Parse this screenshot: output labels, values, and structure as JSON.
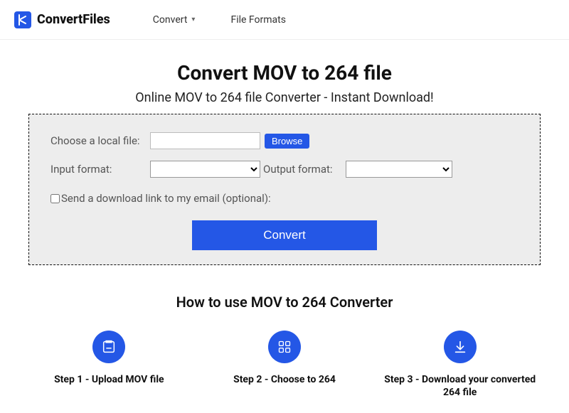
{
  "brand": {
    "name": "ConvertFiles"
  },
  "nav": {
    "convert": "Convert",
    "formats": "File Formats"
  },
  "hero": {
    "title": "Convert MOV to 264 file",
    "subtitle": "Online MOV to 264 file Converter - Instant Download!"
  },
  "form": {
    "choose_label": "Choose a local file:",
    "input_value": "",
    "browse": "Browse",
    "input_format_label": "Input format:",
    "output_format_label": "Output format:",
    "email_opt_label": "Send a download link to my email (optional):",
    "convert_btn": "Convert"
  },
  "howto": {
    "heading": "How to use MOV to 264 Converter",
    "steps": [
      {
        "label": "Step 1 - Upload MOV file"
      },
      {
        "label": "Step 2 - Choose to 264"
      },
      {
        "label": "Step 3 - Download your converted 264 file"
      }
    ]
  }
}
